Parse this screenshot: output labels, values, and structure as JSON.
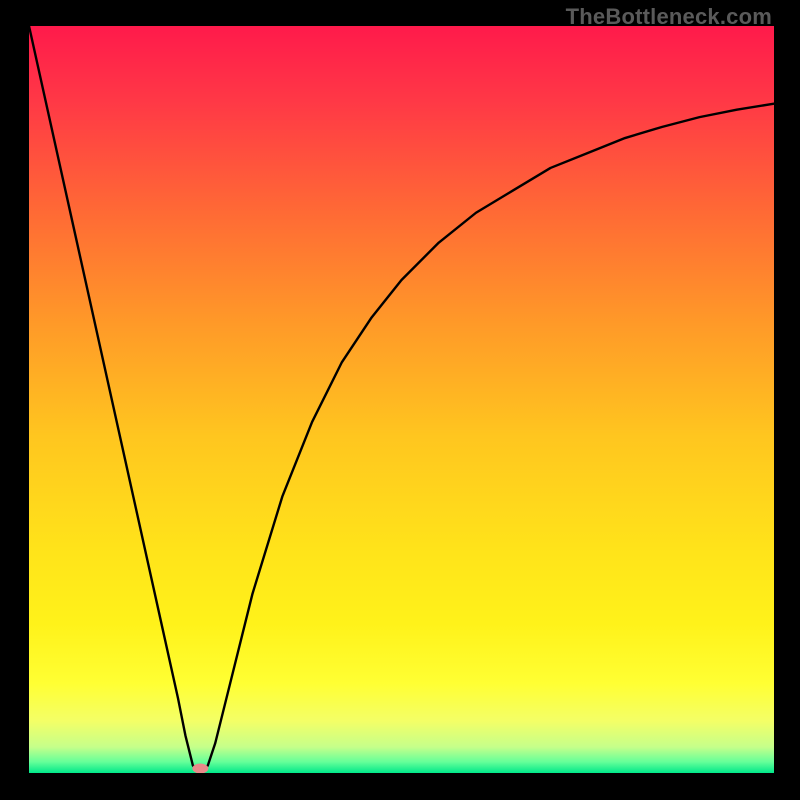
{
  "watermark": "TheBottleneck.com",
  "chart_data": {
    "type": "line",
    "title": "",
    "xlabel": "",
    "ylabel": "",
    "xlim": [
      0,
      100
    ],
    "ylim": [
      0,
      100
    ],
    "curve": {
      "name": "bottleneck-curve",
      "x": [
        0,
        2,
        4,
        6,
        8,
        10,
        12,
        14,
        16,
        18,
        20,
        21,
        22,
        23,
        24,
        25,
        27,
        30,
        34,
        38,
        42,
        46,
        50,
        55,
        60,
        65,
        70,
        75,
        80,
        85,
        90,
        95,
        100
      ],
      "y": [
        100,
        91,
        82,
        73,
        64,
        55,
        46,
        37,
        28,
        19,
        10,
        5,
        1,
        0,
        1,
        4,
        12,
        24,
        37,
        47,
        55,
        61,
        66,
        71,
        75,
        78,
        81,
        83,
        85,
        86.5,
        87.8,
        88.8,
        89.6
      ]
    },
    "marker": {
      "x": 23,
      "y": 0.6,
      "color": "#e98a8a"
    },
    "gradient_stops": [
      {
        "offset": 0.0,
        "color": "#ff1a4b"
      },
      {
        "offset": 0.1,
        "color": "#ff3846"
      },
      {
        "offset": 0.25,
        "color": "#ff6a35"
      },
      {
        "offset": 0.4,
        "color": "#ff9a28"
      },
      {
        "offset": 0.55,
        "color": "#ffc61f"
      },
      {
        "offset": 0.7,
        "color": "#ffe31a"
      },
      {
        "offset": 0.8,
        "color": "#fff21a"
      },
      {
        "offset": 0.88,
        "color": "#ffff33"
      },
      {
        "offset": 0.93,
        "color": "#f4ff66"
      },
      {
        "offset": 0.965,
        "color": "#c6ff8a"
      },
      {
        "offset": 0.985,
        "color": "#66ff99"
      },
      {
        "offset": 1.0,
        "color": "#00e88a"
      }
    ]
  }
}
